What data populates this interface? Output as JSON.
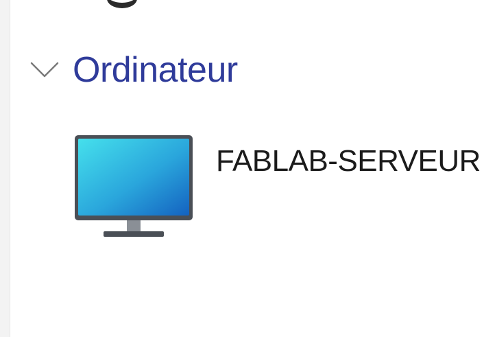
{
  "group": {
    "title": "Ordinateur",
    "expanded": true,
    "chevron_icon": "chevron-down-icon",
    "title_color": "#2f3b9a"
  },
  "items": [
    {
      "label": "FABLAB-SERVEUR",
      "icon": "monitor-icon"
    }
  ],
  "colors": {
    "monitor_screen_light": "#3fd6e8",
    "monitor_screen_dark": "#1672c9",
    "monitor_bezel": "#4a4f56",
    "monitor_stand": "#7a7f86"
  }
}
